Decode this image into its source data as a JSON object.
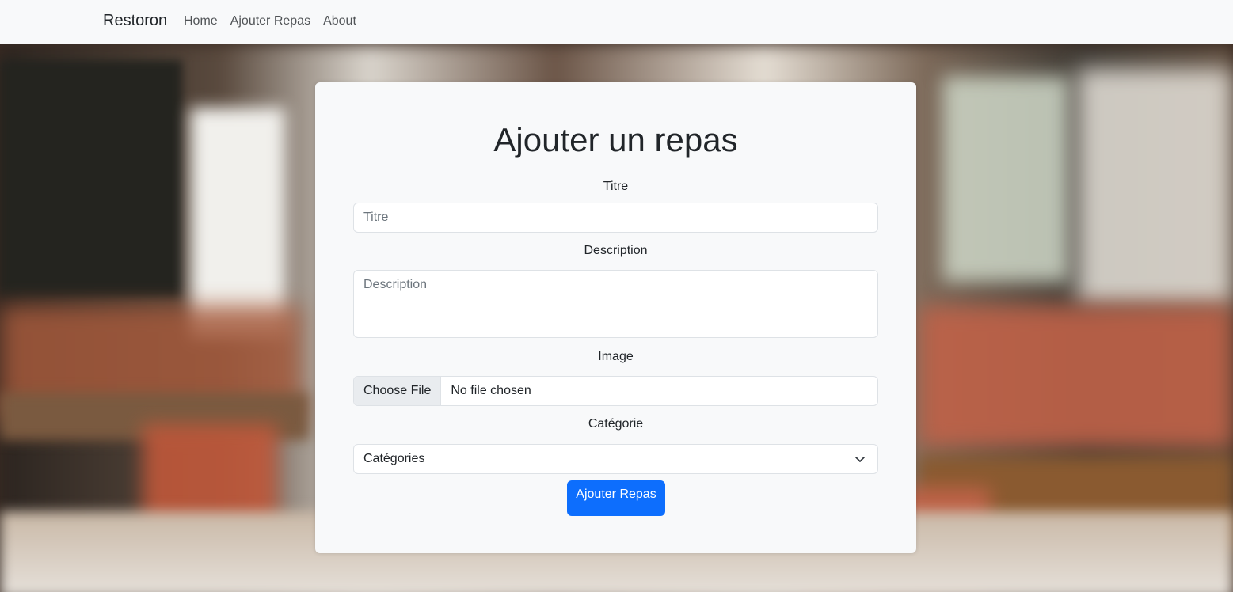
{
  "navbar": {
    "brand": "Restoron",
    "links": [
      "Home",
      "Ajouter Repas",
      "About"
    ]
  },
  "form": {
    "title": "Ajouter un repas",
    "titre": {
      "label": "Titre",
      "placeholder": "Titre"
    },
    "description": {
      "label": "Description",
      "placeholder": "Description"
    },
    "image": {
      "label": "Image",
      "button_label": "Choose File",
      "status": "No file chosen"
    },
    "categorie": {
      "label": "Catégorie",
      "selected": "Catégories"
    },
    "submit_label": "Ajouter Repas"
  },
  "colors": {
    "navbar_bg": "#f8f9fa",
    "card_bg": "#f8f9fa",
    "primary_button": "#0d6efd"
  },
  "icons": {
    "select_arrow": "chevron-down-icon"
  }
}
